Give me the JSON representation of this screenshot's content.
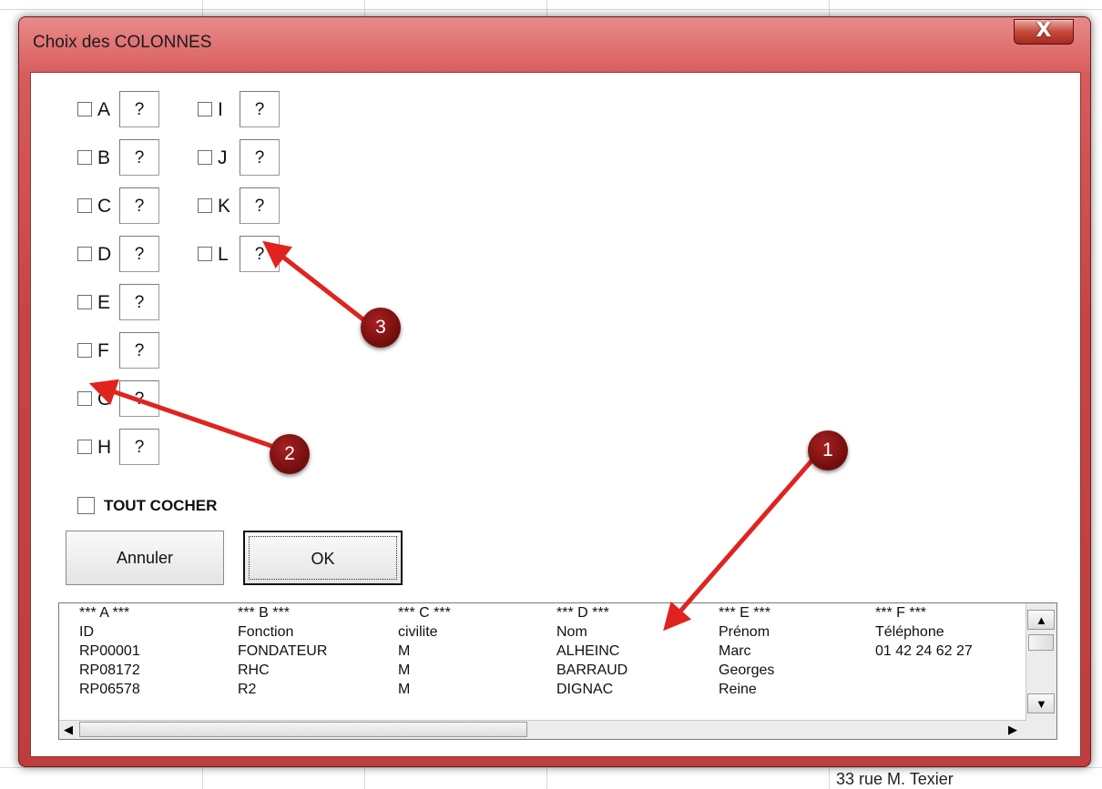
{
  "background": {
    "cell_text": "33 rue M. Texier"
  },
  "dialog": {
    "title": "Choix des COLONNES",
    "close_glyph": "X",
    "column_checkboxes": [
      {
        "letter": "A",
        "value": "?"
      },
      {
        "letter": "B",
        "value": "?"
      },
      {
        "letter": "C",
        "value": "?"
      },
      {
        "letter": "D",
        "value": "?"
      },
      {
        "letter": "E",
        "value": "?"
      },
      {
        "letter": "F",
        "value": "?"
      },
      {
        "letter": "G",
        "value": "?"
      },
      {
        "letter": "H",
        "value": "?"
      },
      {
        "letter": "I",
        "value": "?"
      },
      {
        "letter": "J",
        "value": "?"
      },
      {
        "letter": "K",
        "value": "?"
      },
      {
        "letter": "L",
        "value": "?"
      }
    ],
    "check_all_label": "TOUT COCHER",
    "cancel_label": "Annuler",
    "ok_label": "OK",
    "list": {
      "columns": [
        {
          "header": "*** A ***",
          "cells": [
            "ID",
            "RP00001",
            "RP08172",
            "RP06578"
          ]
        },
        {
          "header": "*** B ***",
          "cells": [
            "Fonction",
            "FONDATEUR",
            "RHC",
            "R2"
          ]
        },
        {
          "header": "*** C ***",
          "cells": [
            "civilite",
            "M",
            "M",
            "M"
          ]
        },
        {
          "header": "*** D ***",
          "cells": [
            "Nom",
            "ALHEINC",
            "BARRAUD",
            "DIGNAC"
          ]
        },
        {
          "header": "*** E ***",
          "cells": [
            "Prénom",
            "Marc",
            "Georges",
            "Reine"
          ]
        },
        {
          "header": "*** F ***",
          "cells": [
            "Téléphone",
            "01 42 24 62 27",
            "",
            ""
          ]
        }
      ]
    }
  },
  "annotations": {
    "badge_1": "1",
    "badge_2": "2",
    "badge_3": "3",
    "arrow_color": "#e0231f"
  }
}
